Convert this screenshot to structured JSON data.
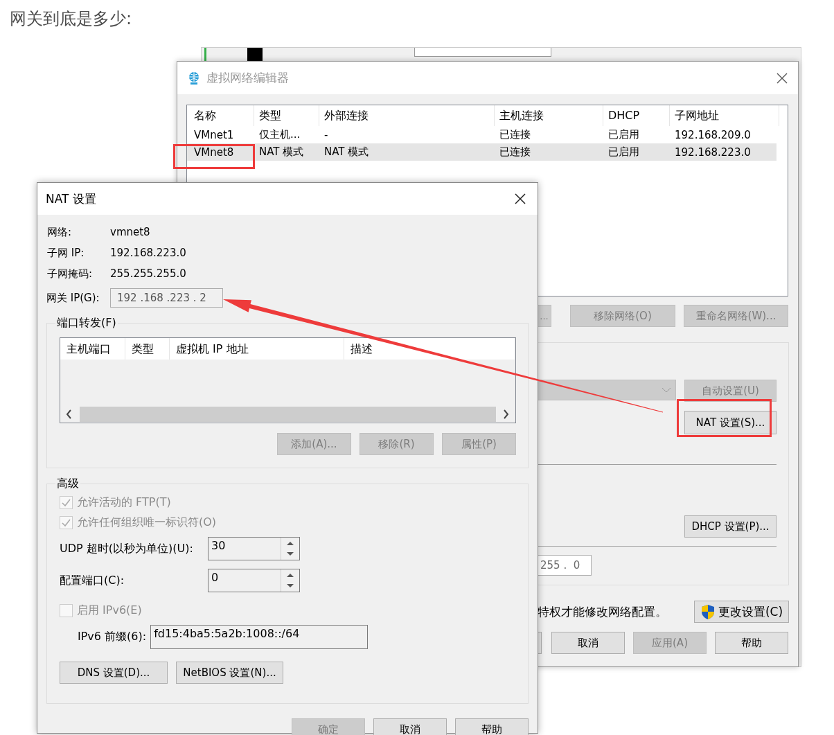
{
  "heading": "网关到底是多少:",
  "editor": {
    "title": "虚拟网络编辑器",
    "table": {
      "columns": [
        "名称",
        "类型",
        "外部连接",
        "主机连接",
        "DHCP",
        "子网地址"
      ],
      "rows": [
        {
          "cells": [
            "VMnet1",
            "仅主机...",
            "-",
            "已连接",
            "已启用",
            "192.168.209.0"
          ],
          "selected": false
        },
        {
          "cells": [
            "VMnet8",
            "NAT 模式",
            "NAT 模式",
            "已连接",
            "已启用",
            "192.168.223.0"
          ],
          "selected": true
        }
      ]
    },
    "network_buttons": [
      {
        "label": "...",
        "disabled": true
      },
      {
        "label": "移除网络(O)",
        "disabled": true
      },
      {
        "label": "重命名网络(W)...",
        "disabled": true
      }
    ],
    "auto_button": {
      "label": "自动设置(U)",
      "disabled": true
    },
    "nat_button": {
      "label": "NAT 设置(S)...",
      "disabled": false
    },
    "dhcp_button": {
      "label": "DHCP 设置(P)...",
      "disabled": false
    },
    "mask_field": {
      "value": "255 .  0"
    },
    "admin_note": "特权才能修改网络配置。",
    "change_button": {
      "label": "更改设置(C)",
      "disabled": false
    },
    "dialog_buttons": [
      {
        "label": "取消",
        "disabled": false
      },
      {
        "label": "应用(A)",
        "disabled": true
      },
      {
        "label": "帮助",
        "disabled": false
      }
    ]
  },
  "nat": {
    "title": "NAT 设置",
    "info": [
      {
        "label": "网络:",
        "value": "vmnet8"
      },
      {
        "label": "子网 IP:",
        "value": "192.168.223.0"
      },
      {
        "label": "子网掩码:",
        "value": "255.255.255.0"
      }
    ],
    "gateway": {
      "label": "网关 IP(G):",
      "value": "192 .168 .223 . 2",
      "disabled": true
    },
    "port_forwarding": {
      "title": "端口转发(F)",
      "columns": [
        "主机端口",
        "类型",
        "虚拟机 IP 地址",
        "描述"
      ],
      "buttons": [
        {
          "label": "添加(A)...",
          "disabled": true
        },
        {
          "label": "移除(R)",
          "disabled": true
        },
        {
          "label": "属性(P)",
          "disabled": true
        }
      ]
    },
    "advanced": {
      "title": "高级",
      "items": [
        {
          "kind": "checkbox",
          "label": "允许活动的 FTP(T)",
          "checked": true,
          "disabled": true
        },
        {
          "kind": "checkbox",
          "label": "允许任何组织唯一标识符(O)",
          "checked": true,
          "disabled": true
        },
        {
          "kind": "spin",
          "label": "UDP 超时(以秒为单位)(U):",
          "value": "30"
        },
        {
          "kind": "spin",
          "label": "配置端口(C):",
          "value": "0"
        },
        {
          "kind": "checkbox",
          "label": "启用 IPv6(E)",
          "checked": false,
          "disabled": true
        },
        {
          "kind": "prefix",
          "label": "IPv6 前缀(6):",
          "value": "fd15:4ba5:5a2b:1008::/64"
        }
      ],
      "buttons": [
        {
          "label": "DNS 设置(D)...",
          "disabled": false
        },
        {
          "label": "NetBIOS 设置(N)...",
          "disabled": false
        }
      ]
    },
    "dialog_buttons": [
      {
        "label": "确定",
        "disabled": true
      },
      {
        "label": "取消",
        "disabled": false
      },
      {
        "label": "帮助",
        "disabled": false
      }
    ]
  }
}
